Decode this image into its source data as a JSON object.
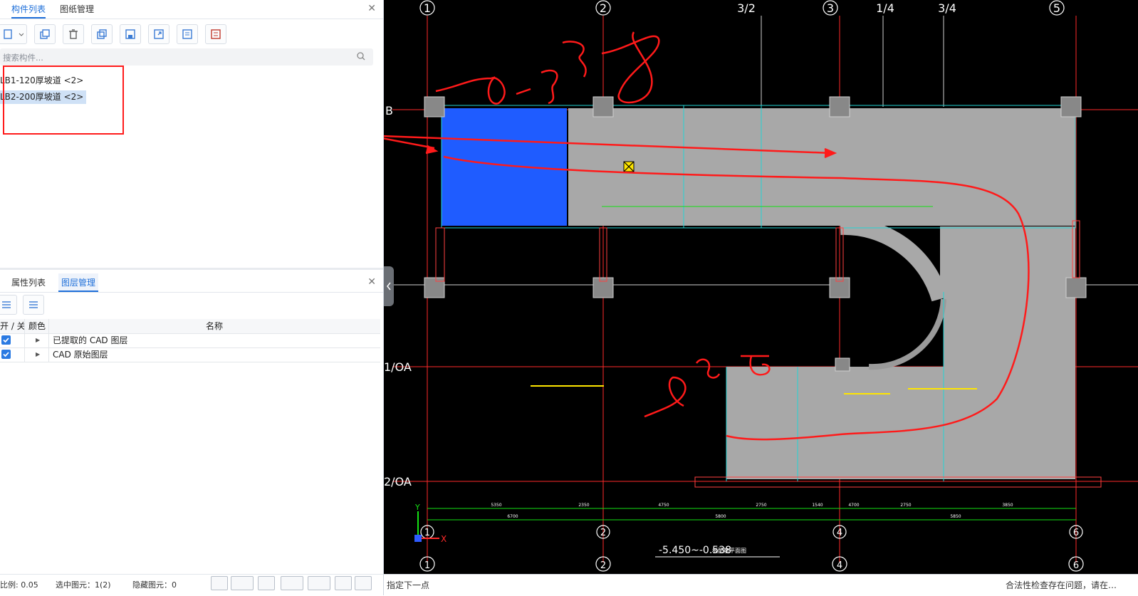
{
  "top_panel": {
    "tabs": [
      "构件列表",
      "图纸管理"
    ],
    "search_placeholder": "搜索构件...",
    "items": [
      "LB1-120厚坡道 <2>",
      "LB2-200厚坡道 <2>"
    ]
  },
  "bottom_panel": {
    "tabs": [
      "属性列表",
      "图层管理"
    ],
    "columns": [
      "开 / 关",
      "颜色",
      "名称"
    ],
    "rows": [
      {
        "name": "已提取的 CAD 图层",
        "on": true
      },
      {
        "name": "CAD 原始图层",
        "on": true
      }
    ]
  },
  "status": {
    "scale": "比例: 0.05",
    "selected": "选中图元：1(2)",
    "hidden": "隐藏图元：0",
    "prompt": "指定下一点",
    "warning": "合法性检查存在问题，请在…"
  },
  "drawing": {
    "axis_top": [
      "1",
      "2",
      "3/2",
      "3",
      "1/4",
      "3/4",
      "5"
    ],
    "axis_bottom": [
      "1",
      "2",
      "4",
      "6"
    ],
    "axis_left": [
      "B",
      "1/OA",
      "2/OA"
    ],
    "title": "-5.450~-0.538",
    "title_suffix": "板配筋平面图",
    "dims_row1": [
      "5350",
      "2350",
      "4750",
      "2750",
      "1540",
      "4700",
      "2750",
      "3850"
    ],
    "dims_row2": [
      "6700",
      "5800",
      "5850"
    ],
    "handwritten": [
      "0.538",
      "-5.45"
    ],
    "coord_x": "X",
    "coord_y": "Y",
    "colors": {
      "slab_selected": "#1f5cff",
      "slab": "#a8a8a8",
      "annotation": "#ff1a1a"
    }
  }
}
